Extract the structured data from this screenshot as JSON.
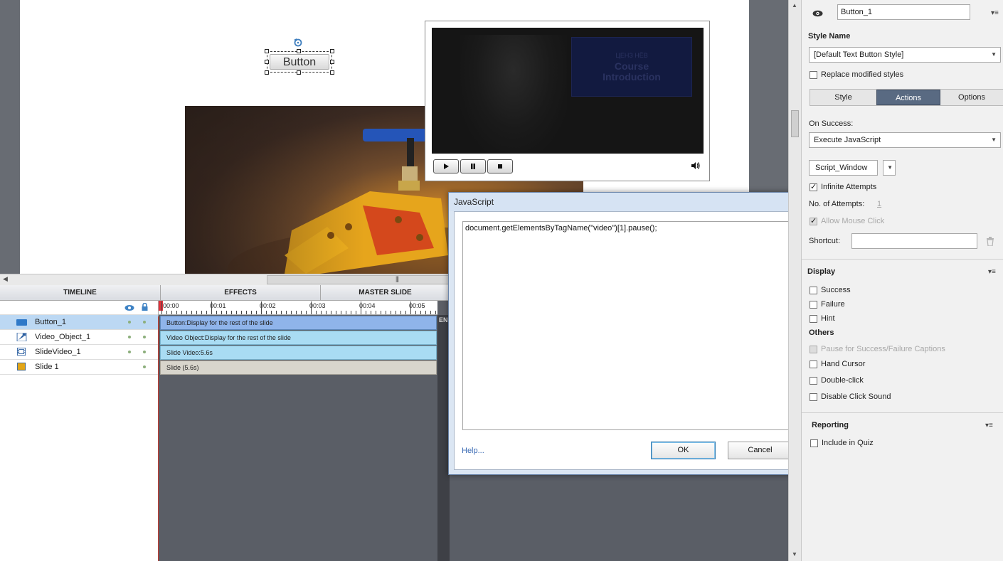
{
  "canvas": {
    "button_label": "Button",
    "video_panel_line1": "Course",
    "video_panel_line2": "Introduction",
    "video_panel_small": "ЦЕНЗ НЁВ"
  },
  "timeline": {
    "tabs": [
      "TIMELINE",
      "EFFECTS",
      "MASTER SLIDE"
    ],
    "ruler": [
      "00:00",
      "00:01",
      "00:02",
      "00:03",
      "00:04",
      "00:05"
    ],
    "end_label": "EN",
    "rows": [
      {
        "name": "Button_1",
        "bar": "Button:Display for the rest of the slide"
      },
      {
        "name": "Video_Object_1",
        "bar": "Video Object:Display for the rest of the slide"
      },
      {
        "name": "SlideVideo_1",
        "bar": "Slide Video:5.6s"
      },
      {
        "name": "Slide 1",
        "bar": "Slide (5.6s)"
      }
    ]
  },
  "dialog": {
    "title": "JavaScript",
    "code": "document.getElementsByTagName(\"video\")[1].pause();",
    "help": "Help...",
    "ok": "OK",
    "cancel": "Cancel"
  },
  "props": {
    "object_name": "Button_1",
    "style_name_label": "Style Name",
    "style_name_value": "[Default Text Button Style]",
    "replace_modified": "Replace modified styles",
    "tabs": [
      "Style",
      "Actions",
      "Options"
    ],
    "active_tab": "Actions",
    "on_success_label": "On Success:",
    "on_success_value": "Execute JavaScript",
    "script_window": "Script_Window",
    "infinite_attempts": "Infinite Attempts",
    "no_of_attempts_label": "No. of Attempts:",
    "no_of_attempts_value": "1",
    "allow_mouse_click": "Allow Mouse Click",
    "shortcut_label": "Shortcut:",
    "display_heading": "Display",
    "display_success": "Success",
    "display_failure": "Failure",
    "display_hint": "Hint",
    "others_heading": "Others",
    "pause_captions": "Pause for Success/Failure Captions",
    "hand_cursor": "Hand Cursor",
    "double_click": "Double-click",
    "disable_click_sound": "Disable Click Sound",
    "reporting_heading": "Reporting",
    "include_in_quiz": "Include in Quiz"
  },
  "colors": {
    "selected_row": "#bcd8f3",
    "button_bar": "#8fb4ea",
    "video_bar": "#a9dcf3",
    "slide_bar": "#d8d5cc",
    "active_tab": "#596a82"
  }
}
